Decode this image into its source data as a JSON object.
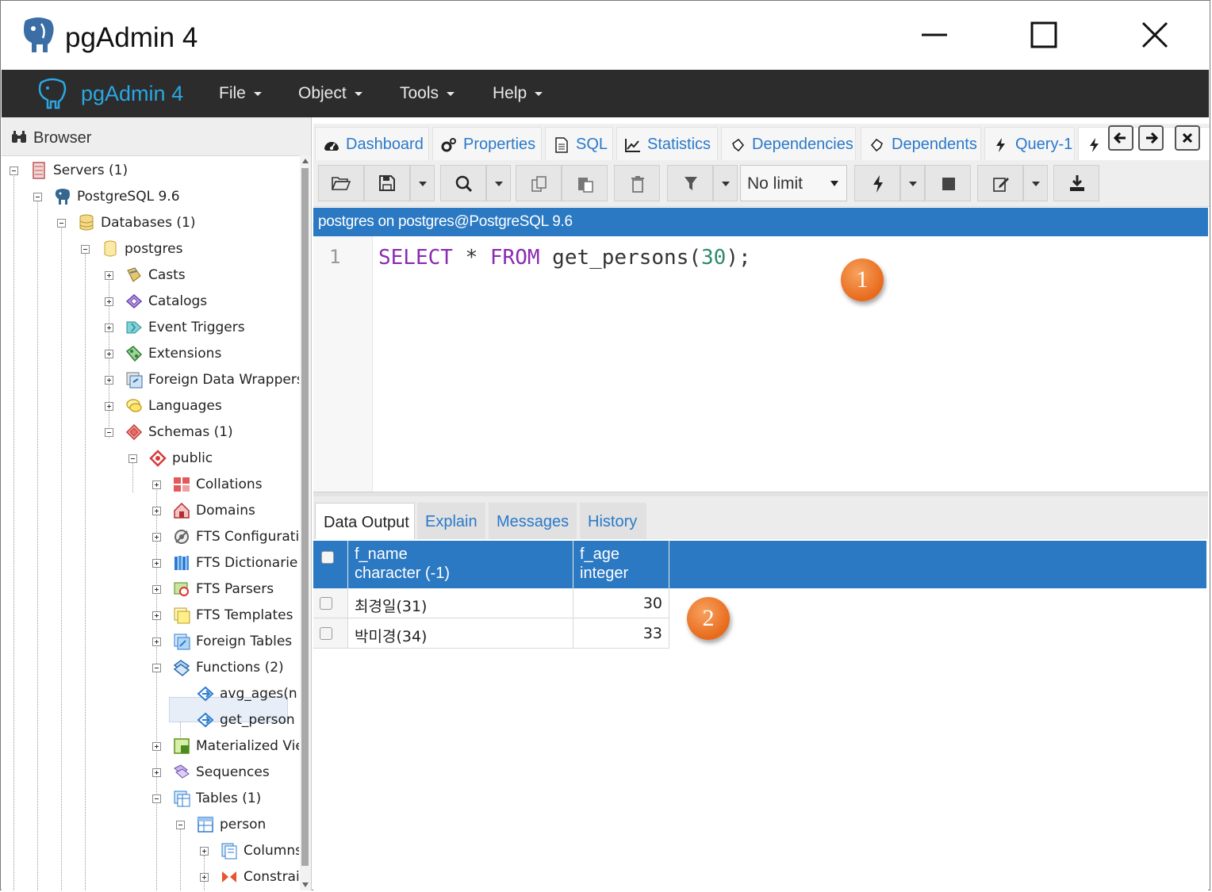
{
  "window": {
    "title": "pgAdmin 4"
  },
  "menubar": {
    "brand": "pgAdmin 4",
    "menus": [
      "File",
      "Object",
      "Tools",
      "Help"
    ]
  },
  "browser": {
    "title": "Browser",
    "tree": [
      "Servers (1)",
      "PostgreSQL 9.6",
      "Databases (1)",
      "postgres",
      "Casts",
      "Catalogs",
      "Event Triggers",
      "Extensions",
      "Foreign Data Wrappers",
      "Languages",
      "Schemas (1)",
      "public",
      "Collations",
      "Domains",
      "FTS Configurati",
      "FTS Dictionarie",
      "FTS Parsers",
      "FTS Templates",
      "Foreign Tables",
      "Functions (2)",
      "avg_ages(n",
      "get_person",
      "Materialized Vie",
      "Sequences",
      "Tables (1)",
      "person",
      "Columns",
      "Constrai"
    ]
  },
  "tabs": [
    "Dashboard",
    "Properties",
    "SQL",
    "Statistics",
    "Dependencies",
    "Dependents",
    "Query-1"
  ],
  "toolbar": {
    "limit": "No limit"
  },
  "connection": "postgres on postgres@PostgreSQL 9.6",
  "editor": {
    "line_number": "1",
    "kw_select": "SELECT",
    "star": " * ",
    "kw_from": "FROM",
    "func": " get_persons(",
    "arg": "30",
    "tail": ");"
  },
  "result_tabs": [
    "Data Output",
    "Explain",
    "Messages",
    "History"
  ],
  "grid": {
    "columns": [
      {
        "name": "f_name",
        "type": "character (-1)"
      },
      {
        "name": "f_age",
        "type": "integer"
      }
    ],
    "rows": [
      {
        "f_name": "최경일(31)",
        "f_age": "30"
      },
      {
        "f_name": "박미경(34)",
        "f_age": "33"
      }
    ]
  },
  "badges": [
    "1",
    "2"
  ],
  "colors": {
    "accent_blue": "#2b79c3",
    "menubar": "#2c2c2c",
    "brand": "#2aa7e3",
    "badge": "#e86a1c"
  }
}
